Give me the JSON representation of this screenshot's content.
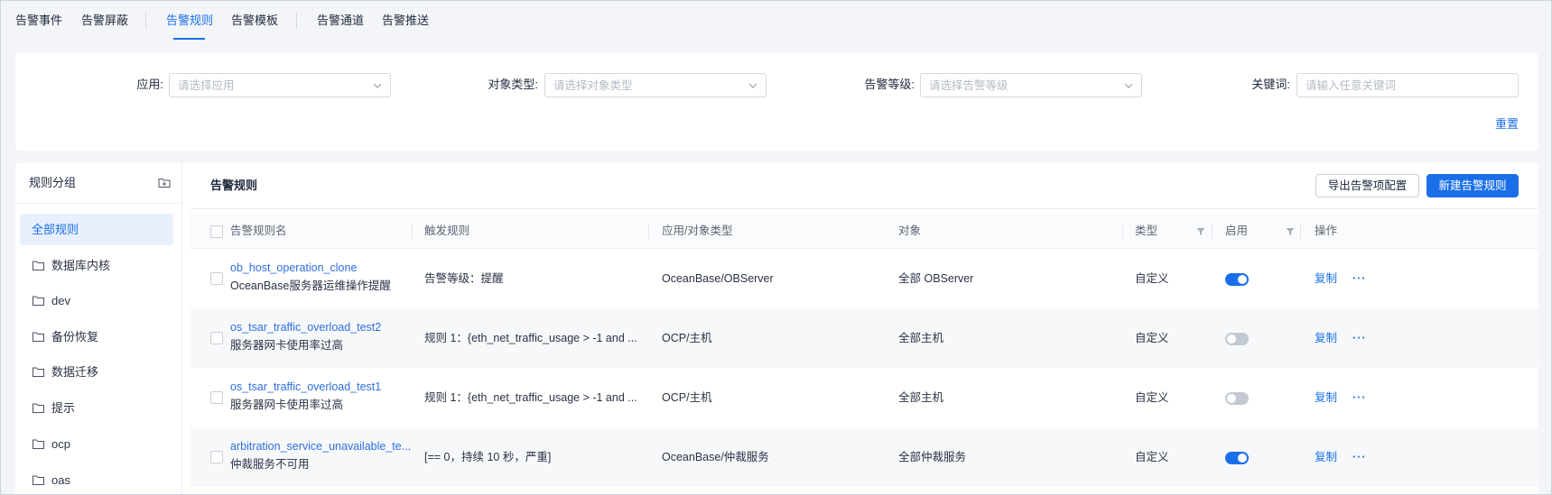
{
  "nav": {
    "tabs": [
      {
        "label": "告警事件",
        "active": false
      },
      {
        "label": "告警屏蔽",
        "active": false
      },
      {
        "label": "告警规则",
        "active": true
      },
      {
        "label": "告警模板",
        "active": false
      },
      {
        "label": "告警通道",
        "active": false
      },
      {
        "label": "告警推送",
        "active": false
      }
    ]
  },
  "filters": {
    "app": {
      "label": "应用:",
      "placeholder": "请选择应用"
    },
    "object_type": {
      "label": "对象类型:",
      "placeholder": "请选择对象类型"
    },
    "level": {
      "label": "告警等级:",
      "placeholder": "请选择告警等级"
    },
    "keyword": {
      "label": "关键词:",
      "placeholder": "请输入任意关键词"
    },
    "reset_label": "重置"
  },
  "sidebar": {
    "title": "规则分组",
    "add_icon": "folder-add-icon",
    "items": [
      {
        "label": "全部规则",
        "active": true
      },
      {
        "label": "数据库内核",
        "icon": "folder-icon",
        "active": false
      },
      {
        "label": "dev",
        "icon": "folder-icon",
        "active": false
      },
      {
        "label": "备份恢复",
        "icon": "folder-icon",
        "active": false
      },
      {
        "label": "数据迁移",
        "icon": "folder-icon",
        "active": false
      },
      {
        "label": "提示",
        "icon": "folder-icon",
        "active": false
      },
      {
        "label": "ocp",
        "icon": "folder-icon",
        "active": false
      },
      {
        "label": "oas",
        "icon": "folder-icon",
        "active": false
      }
    ]
  },
  "panel": {
    "title": "告警规则",
    "export_label": "导出告警项配置",
    "create_label": "新建告警规则"
  },
  "table": {
    "columns": {
      "name": "告警规则名",
      "trigger": "触发规则",
      "app_type": "应用/对象类型",
      "object": "对象",
      "type": "类型",
      "enabled": "启用",
      "actions": "操作"
    },
    "actions": {
      "copy": "复制",
      "more": "···"
    },
    "rows": [
      {
        "name": "ob_host_operation_clone",
        "description": "OceanBase服务器运维操作提醒",
        "trigger": "告警等级：提醒",
        "app_type": "OceanBase/OBServer",
        "object": "全部 OBServer",
        "type": "自定义",
        "enabled": true
      },
      {
        "name": "os_tsar_traffic_overload_test2",
        "description": "服务器网卡使用率过高",
        "trigger": "规则 1：{eth_net_traffic_usage > -1 and ...",
        "app_type": "OCP/主机",
        "object": "全部主机",
        "type": "自定义",
        "enabled": false
      },
      {
        "name": "os_tsar_traffic_overload_test1",
        "description": "服务器网卡使用率过高",
        "trigger": "规则 1：{eth_net_traffic_usage > -1 and ...",
        "app_type": "OCP/主机",
        "object": "全部主机",
        "type": "自定义",
        "enabled": false
      },
      {
        "name": "arbitration_service_unavailable_te...",
        "description": "仲裁服务不可用",
        "trigger": "[== 0，持续 10 秒，严重]",
        "app_type": "OceanBase/仲裁服务",
        "object": "全部仲裁服务",
        "type": "自定义",
        "enabled": true
      }
    ]
  },
  "colors": {
    "accent": "#1a6fe8",
    "row_alt": "#f6f8fa",
    "active_bg": "#e8f0fd",
    "toggle_off": "#c3c9d2"
  }
}
